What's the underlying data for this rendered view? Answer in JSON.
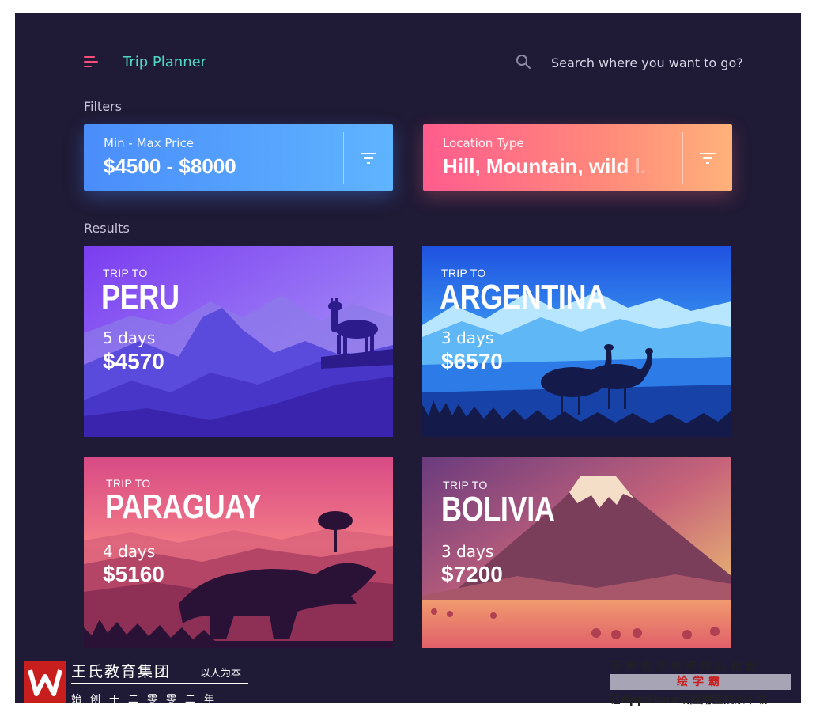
{
  "header": {
    "title": "Trip Planner",
    "search_placeholder": "Search where you want to go?"
  },
  "filters": {
    "section_label": "Filters",
    "price": {
      "label": "Min - Max Price",
      "value": "$4500 - $8000"
    },
    "location": {
      "label": "Location Type",
      "value": "Hill, Mountain, wild l.."
    }
  },
  "results": {
    "section_label": "Results",
    "cards": [
      {
        "prefix": "TRIP TO",
        "country": "PERU",
        "days": "5 days",
        "price": "$4570"
      },
      {
        "prefix": "TRIP TO",
        "country": "ARGENTINA",
        "days": "3 days",
        "price": "$6570"
      },
      {
        "prefix": "TRIP TO",
        "country": "PARAGUAY",
        "days": "4 days",
        "price": "$5160"
      },
      {
        "prefix": "TRIP TO",
        "country": "BOLIVIA",
        "days": "3 days",
        "price": "$7200"
      }
    ]
  },
  "watermark": {
    "left_title": "王氏教育集团",
    "left_motto": "以人为本",
    "left_sub": "始创于二零零二年",
    "right_line1": "获得更多免费精品教程",
    "right_brand": "绘学霸",
    "right_line3_a": "在",
    "right_line3_b": "AppStore",
    "right_line3_c": "或",
    "right_line3_d": "应用宝",
    "right_line3_e": "搜索下载"
  },
  "colors": {
    "background": "#1f1a35",
    "accent_title": "#4fd9c4",
    "menu_icon": "#ff4d7a",
    "price_filter": "#4a8dfb",
    "location_filter": "#ff6f86"
  },
  "icons": [
    "menu-icon",
    "search-icon",
    "filter-icon"
  ]
}
